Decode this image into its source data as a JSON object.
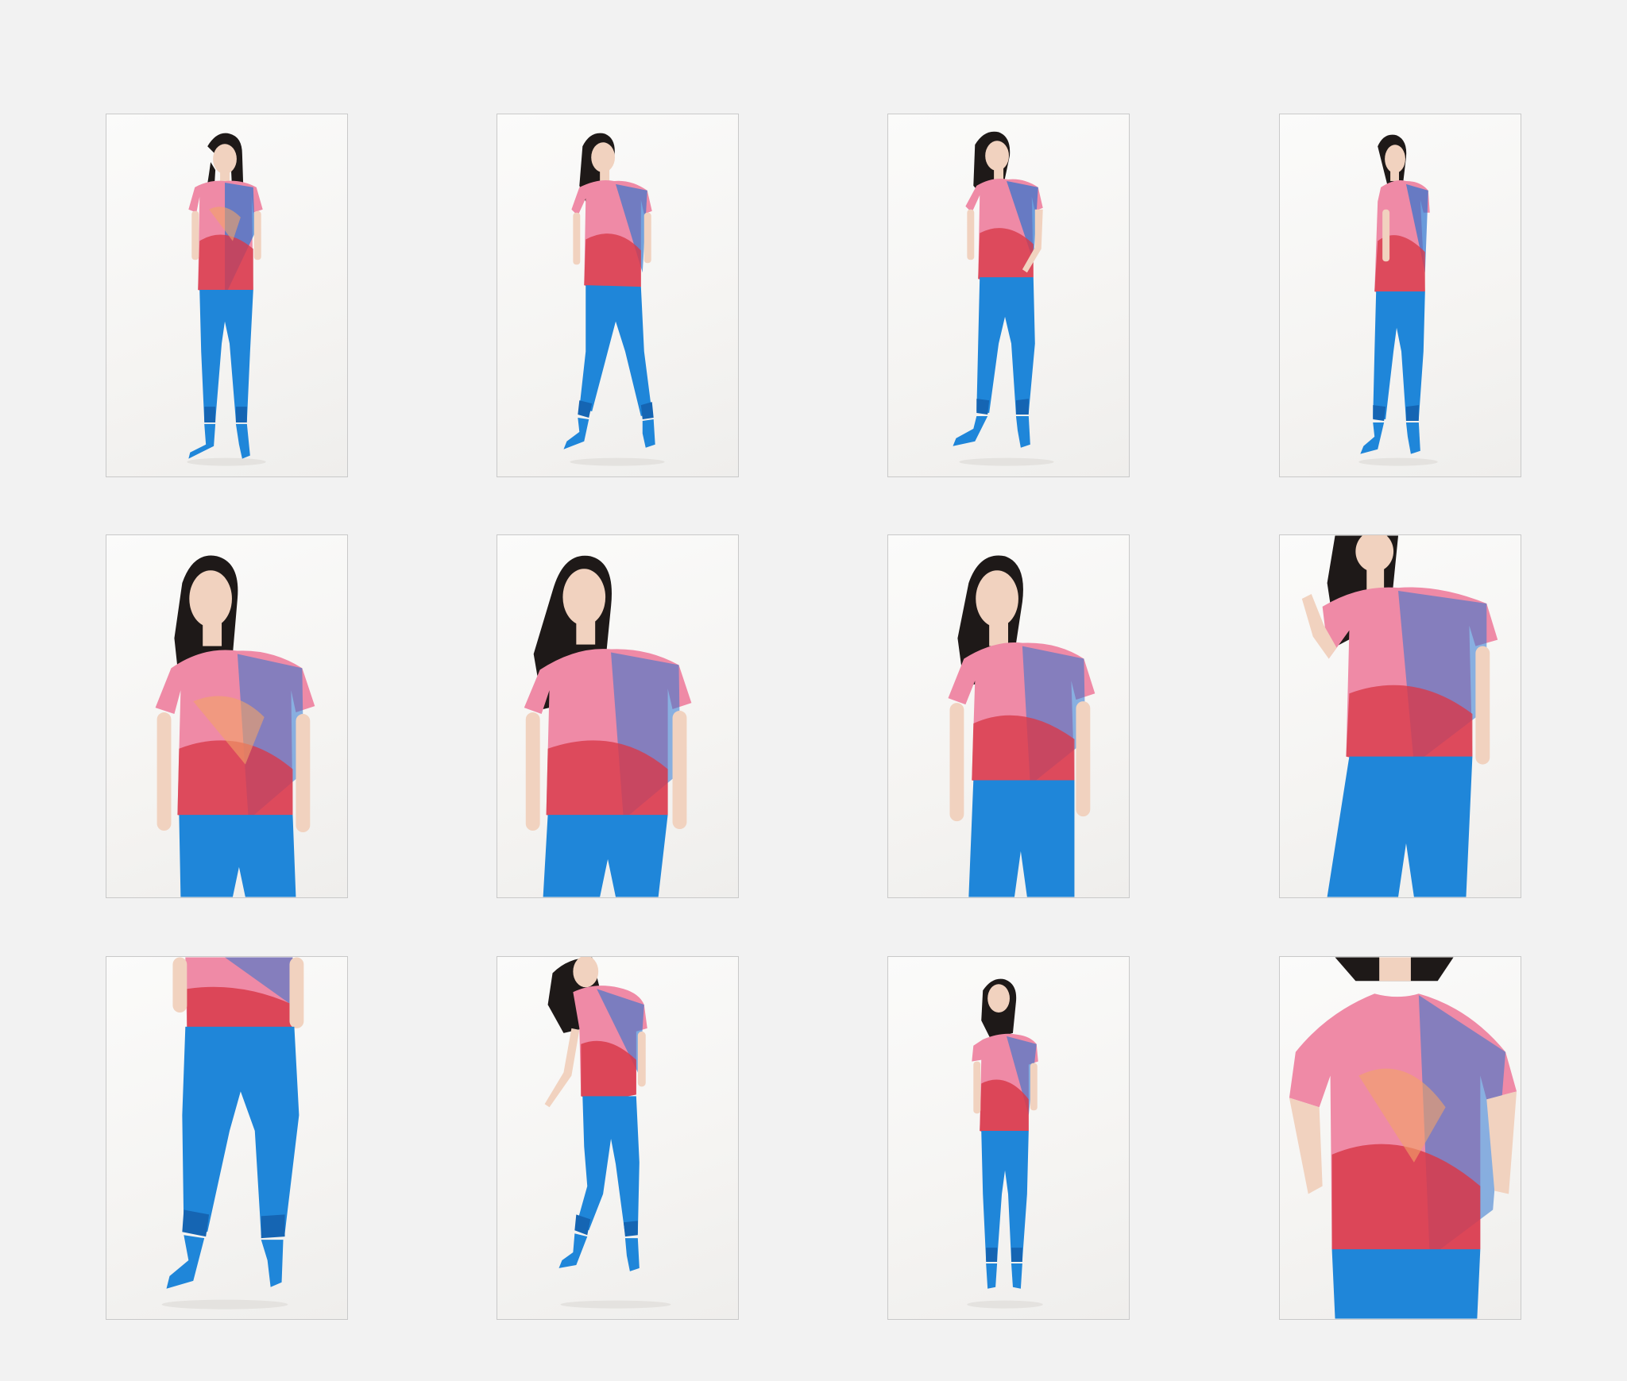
{
  "gallery": {
    "background": "#f2f2f2",
    "palette": {
      "pants_blue": "#1f86d9",
      "pants_blue_dark": "#1565b3",
      "top_pink": "#ef8aa6",
      "top_red": "#d8394a",
      "top_blue": "#2d74d0",
      "top_orange": "#f2a467",
      "skin": "#f1d2bf",
      "hair": "#1e1918"
    },
    "thumbnails": [
      {
        "view": "full-front"
      },
      {
        "view": "full-front-turned"
      },
      {
        "view": "full-hand-in-pocket"
      },
      {
        "view": "full-side"
      },
      {
        "view": "mid-front-looking-left"
      },
      {
        "view": "mid-front-smiling"
      },
      {
        "view": "mid-front-head-tilt"
      },
      {
        "view": "mid-arm-raised"
      },
      {
        "view": "lower-body-pants"
      },
      {
        "view": "full-side-walking"
      },
      {
        "view": "full-back"
      },
      {
        "view": "top-closeup"
      }
    ]
  }
}
